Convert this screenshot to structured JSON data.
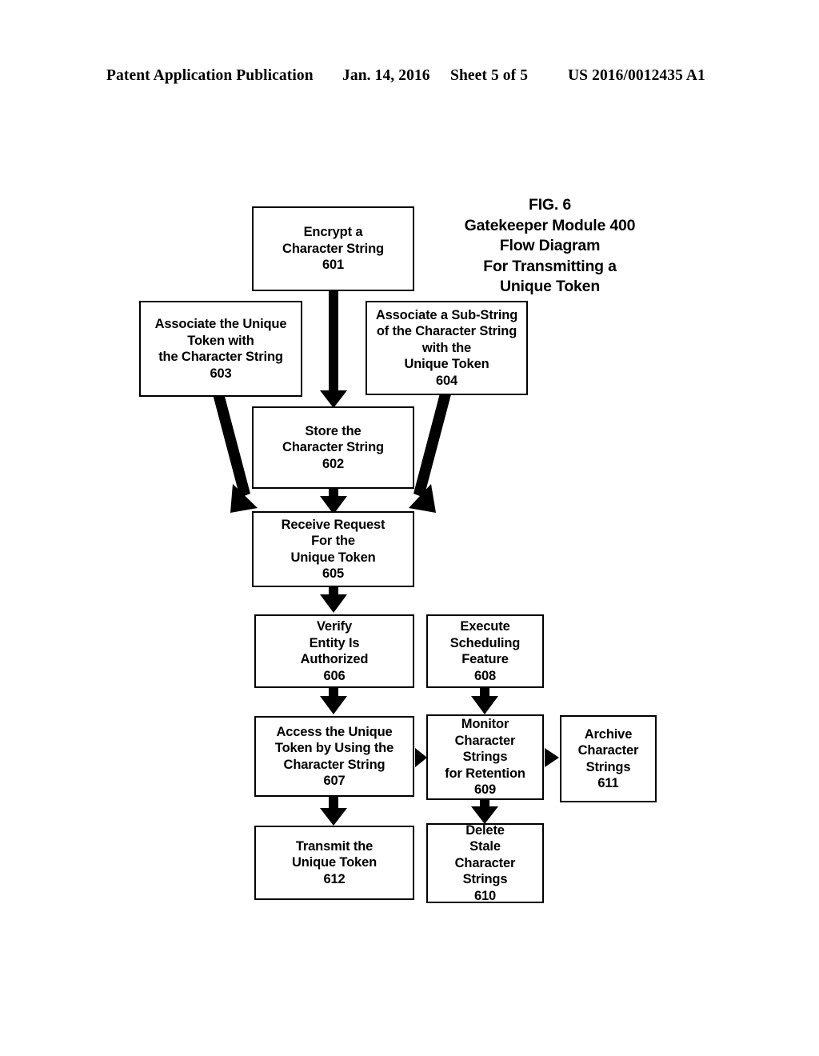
{
  "header": {
    "publication": "Patent Application Publication",
    "date": "Jan. 14, 2016",
    "sheet": "Sheet 5 of 5",
    "patent_number": "US 2016/0012435 A1"
  },
  "figure": {
    "title_lines": [
      "FIG. 6",
      "Gatekeeper Module 400",
      "Flow Diagram",
      "For Transmitting a",
      "Unique Token"
    ],
    "boxes": {
      "b601": {
        "lines": [
          "Encrypt a",
          "Character String",
          "601"
        ],
        "ref": "601"
      },
      "b603": {
        "lines": [
          "Associate the Unique",
          "Token with",
          "the Character String",
          "603"
        ],
        "ref": "603"
      },
      "b604": {
        "lines": [
          "Associate a Sub-String",
          "of the Character String",
          "with the",
          "Unique Token",
          "604"
        ],
        "ref": "604"
      },
      "b602": {
        "lines": [
          "Store the",
          "Character String",
          "602"
        ],
        "ref": "602"
      },
      "b605": {
        "lines": [
          "Receive Request",
          "For the",
          "Unique Token",
          "605"
        ],
        "ref": "605"
      },
      "b606": {
        "lines": [
          "Verify",
          "Entity Is",
          "Authorized",
          "606"
        ],
        "ref": "606"
      },
      "b608": {
        "lines": [
          "Execute",
          "Scheduling",
          "Feature",
          "608"
        ],
        "ref": "608"
      },
      "b607": {
        "lines": [
          "Access the Unique",
          "Token by Using the",
          "Character String",
          "607"
        ],
        "ref": "607"
      },
      "b609": {
        "lines": [
          "Monitor",
          "Character",
          "Strings",
          "for Retention",
          "609"
        ],
        "ref": "609"
      },
      "b611": {
        "lines": [
          "Archive",
          "Character",
          "Strings",
          "611"
        ],
        "ref": "611"
      },
      "b612": {
        "lines": [
          "Transmit the",
          "Unique Token",
          "612"
        ],
        "ref": "612"
      },
      "b610": {
        "lines": [
          "Delete",
          "Stale",
          "Character",
          "Strings",
          "610"
        ],
        "ref": "610"
      }
    },
    "colors": {
      "ink": "#000000",
      "paper": "#ffffff"
    }
  }
}
